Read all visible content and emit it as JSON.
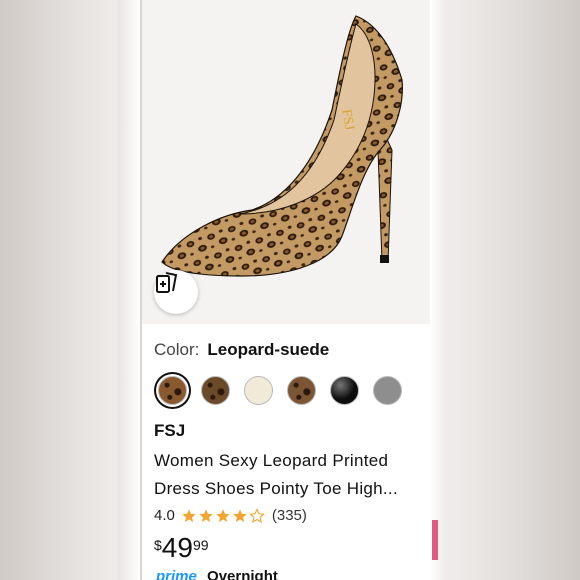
{
  "product": {
    "color_label": "Color:",
    "color_value": "Leopard-suede",
    "brand": "FSJ",
    "title_line1": "Women Sexy Leopard Printed",
    "title_line2": "Dress Shoes Pointy Toe High...",
    "rating_value": "4.0",
    "rating_stars": 4,
    "rating_count": "(335)",
    "price_currency": "$",
    "price_whole": "49",
    "price_fraction": "99",
    "prime_label": "prime",
    "delivery_text": "Overnight"
  },
  "swatches": [
    {
      "name": "leopard-suede",
      "color": "#8a5a2e",
      "selected": true
    },
    {
      "name": "leopard-dark",
      "color": "#6b4a2a",
      "selected": false
    },
    {
      "name": "beige",
      "color": "#f1ead8",
      "selected": false
    },
    {
      "name": "leopard-brown",
      "color": "#7c5535",
      "selected": false
    },
    {
      "name": "black",
      "color": "#0d0d0d",
      "selected": false
    },
    {
      "name": "snake",
      "color": "#8e8e8e",
      "selected": false
    }
  ],
  "colors": {
    "star": "#f3a431",
    "prime_blue": "#1a98ff"
  },
  "icons": {
    "compare": "compare-cards-icon"
  }
}
